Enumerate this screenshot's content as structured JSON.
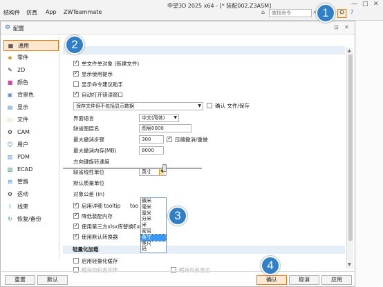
{
  "topbar": {
    "menus": [
      "结构件",
      "仿真",
      "App",
      "ZWTeammate"
    ],
    "title": "中望3D 2025 x64 - [* 装配002.Z3ASM]",
    "search_placeholder": "查找命令",
    "win_controls": [
      "—",
      "□",
      "✕"
    ],
    "gear_symbol": "⚙",
    "help_symbol": "?"
  },
  "dialog": {
    "title": "配置",
    "title_controls": [
      "⊡",
      "✕"
    ]
  },
  "sidebar": {
    "items": [
      {
        "label": "通用",
        "icon": "▦"
      },
      {
        "label": "零件",
        "icon": "◆"
      },
      {
        "label": "2D",
        "icon": "✎"
      },
      {
        "label": "颜色",
        "icon": "■"
      },
      {
        "label": "背景色",
        "icon": "▣"
      },
      {
        "label": "显示",
        "icon": "▤"
      },
      {
        "label": "文件",
        "icon": "▭"
      },
      {
        "label": "CAM",
        "icon": "⚙"
      },
      {
        "label": "用户",
        "icon": "☺"
      },
      {
        "label": "PDM",
        "icon": "▥"
      },
      {
        "label": "ECAD",
        "icon": "▧"
      },
      {
        "label": "管路",
        "icon": "⊞"
      },
      {
        "label": "运动",
        "icon": "⚙"
      },
      {
        "label": "线束",
        "icon": "⌇"
      },
      {
        "label": "恢复/备份",
        "icon": "↻"
      }
    ]
  },
  "general": {
    "checkboxes": [
      {
        "label": "单文件单对象 (新建文件)",
        "checked": true
      },
      {
        "label": "显示使用提示",
        "checked": true
      },
      {
        "label": "显示命令建议助手",
        "checked": false
      },
      {
        "label": "自动打开错误窗口",
        "checked": true
      }
    ],
    "save_option": "保存文件但不包括显示数据",
    "confirm_save_label": "确认 文件/保存",
    "language_label": "界面语言",
    "language_value": "中文(简体)",
    "default_layer_label": "缺省图层名",
    "default_layer_value": "图层0000",
    "max_undo_label": "最大撤消步骤",
    "max_undo_value": "300",
    "compress_undo_label": "压缩撤消/重做",
    "max_undo_mem_label": "最大撤消内存(MB)",
    "max_undo_mem_value": "8000",
    "rotate_speed_label": "方向键旋转速度",
    "linear_unit_label": "缺省线性单位",
    "linear_unit_value": "英寸",
    "unit_options": [
      "微米",
      "毫米",
      "厘米",
      "分米",
      "米",
      "密耳",
      "英寸",
      "英尺",
      "码"
    ],
    "unit_selected_index": 6,
    "mass_unit_label": "默认质量单位",
    "tolerance_label": "对象公差 (in)",
    "tooltip_label": "启用详细 tooltip",
    "tooltip_suffix": "too",
    "reduce_mem_label": "降低装配内存",
    "third_party_label": "使用第三方xlsx库替换Exce",
    "default_converter_label": "使用默认转换器",
    "lightweight_title": "轻量化加载",
    "lightweight_cache_label": "启用轻量化缓存",
    "cache_a": "缓存内包含实体",
    "cache_b": "缓存内包含边"
  },
  "buttons": {
    "reset": "重置",
    "default": "默认",
    "ok": "确认",
    "cancel": "取消",
    "apply": "应用"
  },
  "callouts": [
    "1",
    "2",
    "3",
    "4"
  ],
  "colors": {
    "accent": "#e07a14",
    "callout": "#2f7fc9"
  }
}
